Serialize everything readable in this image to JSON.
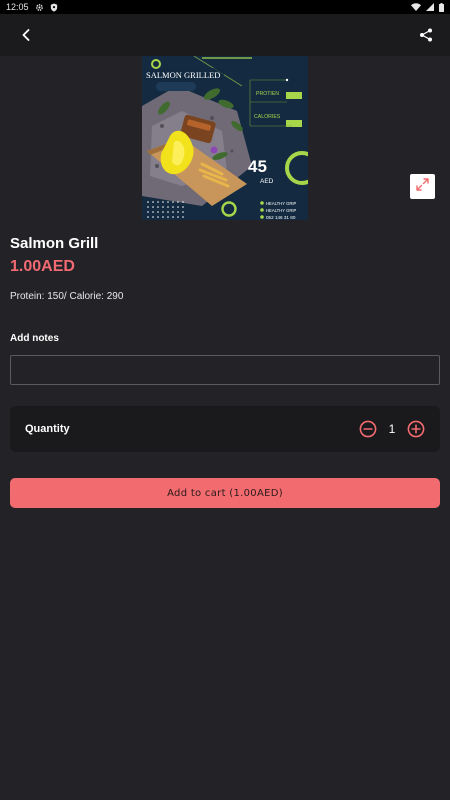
{
  "status_bar": {
    "time": "12:05",
    "icons": [
      "settings-icon",
      "shield-icon",
      "wifi-icon",
      "cellular-icon",
      "battery-icon"
    ]
  },
  "app_bar": {
    "icons": [
      "back-arrow-icon",
      "share-icon"
    ]
  },
  "hero_image": {
    "brand_heading": "SALMON GRILLED",
    "stat_labels": [
      "PROTIEN",
      "CALORIES"
    ],
    "price_number": "45",
    "price_currency": "AED",
    "contacts": [
      "HEALTHY GRIP",
      "HEALTHY GRIP",
      "052 146 31 80"
    ]
  },
  "product": {
    "name": "Salmon Grill",
    "price": "1.00AED",
    "description": "Protein: 150/ Calorie: 290"
  },
  "notes": {
    "label": "Add notes",
    "value": "",
    "placeholder": ""
  },
  "quantity": {
    "label": "Quantity",
    "value": "1"
  },
  "cart_button": {
    "label": "Add to cart",
    "total": "(1.00AED)"
  },
  "colors": {
    "accent": "#f26b6f",
    "price": "#f26a72",
    "background": "#232327",
    "card": "#1a1a1d",
    "hero_green": "#a8d64a",
    "hero_navy": "#132a40"
  }
}
